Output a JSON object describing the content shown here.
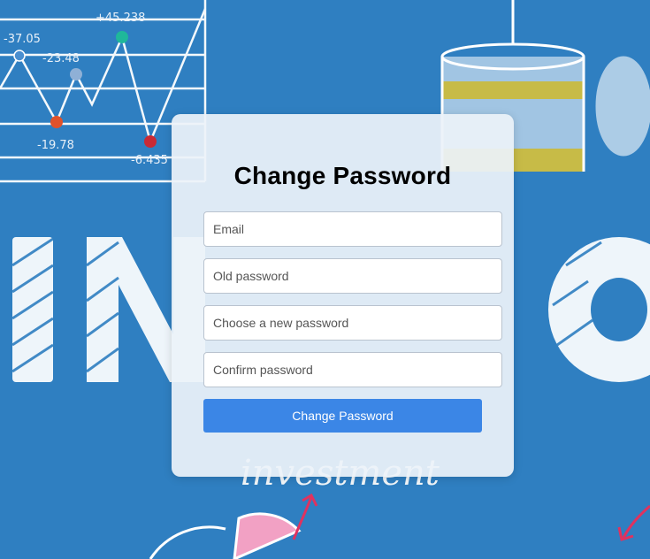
{
  "background": {
    "chart_labels": [
      "-37.05",
      "-23.48",
      "+45.238",
      "-19.78",
      "-6.435"
    ],
    "word": "investment",
    "color": "#2f7fc1"
  },
  "form": {
    "title": "Change Password",
    "email_placeholder": "Email",
    "old_password_placeholder": "Old password",
    "new_password_placeholder": "Choose a new password",
    "confirm_password_placeholder": "Confirm password",
    "submit_label": "Change Password",
    "accent_color": "#3b86e6"
  }
}
